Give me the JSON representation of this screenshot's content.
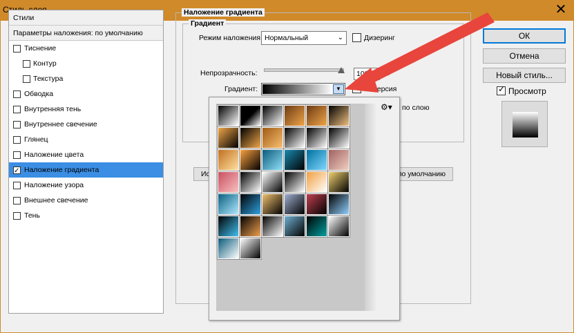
{
  "window": {
    "title": "Стиль слоя"
  },
  "styles_panel": {
    "header": "Стили",
    "blending_options": "Параметры наложения: по умолчанию",
    "items": [
      {
        "label": "Тиснение",
        "checked": false,
        "indent": false,
        "selected": false
      },
      {
        "label": "Контур",
        "checked": false,
        "indent": true,
        "selected": false
      },
      {
        "label": "Текстура",
        "checked": false,
        "indent": true,
        "selected": false
      },
      {
        "label": "Обводка",
        "checked": false,
        "indent": false,
        "selected": false
      },
      {
        "label": "Внутренняя тень",
        "checked": false,
        "indent": false,
        "selected": false
      },
      {
        "label": "Внутреннее свечение",
        "checked": false,
        "indent": false,
        "selected": false
      },
      {
        "label": "Глянец",
        "checked": false,
        "indent": false,
        "selected": false
      },
      {
        "label": "Наложение цвета",
        "checked": false,
        "indent": false,
        "selected": false
      },
      {
        "label": "Наложение градиента",
        "checked": true,
        "indent": false,
        "selected": true
      },
      {
        "label": "Наложение узора",
        "checked": false,
        "indent": false,
        "selected": false
      },
      {
        "label": "Внешнее свечение",
        "checked": false,
        "indent": false,
        "selected": false
      },
      {
        "label": "Тень",
        "checked": false,
        "indent": false,
        "selected": false
      }
    ]
  },
  "gradient_overlay": {
    "group_title": "Наложение градиента",
    "subgroup_title": "Градиент",
    "blend_mode_label": "Режим наложения:",
    "blend_mode_value": "Нормальный",
    "dither_label": "Дизеринг",
    "opacity_label": "Непрозрачность:",
    "opacity_value": "100",
    "opacity_unit": "%",
    "opacity_level": 1.0,
    "gradient_label": "Градиент:",
    "reverse_label": "Инверсия",
    "align_label": "по слою",
    "left_button_fragment": "Ис",
    "default_button": "по умолчанию"
  },
  "gradient_picker": {
    "menu_icon": "gear-icon",
    "swatches": [
      [
        "#000000,#ffffff",
        "#000000,#000000,#ffffff",
        "#000000,#ffffff",
        "#6b3a12,#f0a64a",
        "#6b3a12,#f0a64a",
        "#000000,#f0c080"
      ],
      [
        "#f0a64a,#000000",
        "#000000,#f0a64a",
        "#a05a14,#f8c070",
        "#000000,#ffffff",
        "#000000,#ffffff",
        "#000000,#ffffff"
      ],
      [
        "#c07020,#ffe0a0",
        "#f8a040,#000000",
        "#0a5a7a,#90e0f8",
        "#1a8ab0,#000000",
        "#0070a0,#80d8ff",
        "#a06060,#f0d0c0"
      ],
      [
        "#c85060,#f8c0c0",
        "#000000,#ffffff",
        "#ffffff,#000000",
        "#000000,#ffffff",
        "#f0a040,#ffffff",
        "#f0d070,#000000"
      ],
      [
        "#0a6080,#b0e8ff",
        "#000000,#30a0e0",
        "#f0c070,#000000",
        "#a0b0d0,#000000",
        "#c04050,#000000",
        "#000000,#90d0ff"
      ],
      [
        "#000000,#40c0f0",
        "#000000,#f0a050",
        "#000000,#ffffff",
        "#70b0d0,#000000",
        "#000000,#00a0a0",
        "#ffffff,#000000"
      ],
      [
        "#0a5a7a,#ffffff",
        "#ffffff,#000000"
      ]
    ]
  },
  "buttons": {
    "ok": "ОК",
    "cancel": "Отмена",
    "new_style": "Новый стиль...",
    "preview_label": "Просмотр",
    "preview_checked": true
  },
  "colors": {
    "title_bar": "#d08a2a",
    "selection": "#3b8ee4",
    "arrow": "#e8453c"
  }
}
